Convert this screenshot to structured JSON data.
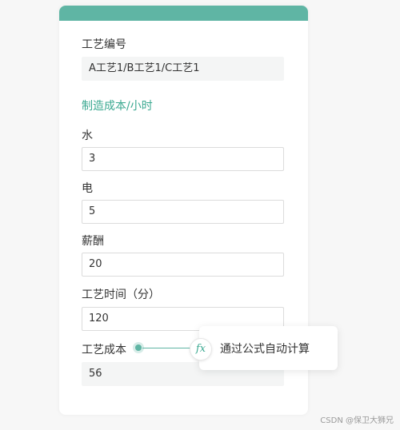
{
  "form": {
    "process_id_label": "工艺编号",
    "process_id_value": "A工艺1/B工艺1/C工艺1",
    "section_heading": "制造成本/小时",
    "water_label": "水",
    "water_value": "3",
    "electricity_label": "电",
    "electricity_value": "5",
    "salary_label": "薪酬",
    "salary_value": "20",
    "process_time_label": "工艺时间（分）",
    "process_time_value": "120",
    "process_cost_label": "工艺成本",
    "process_cost_value": "56"
  },
  "formula_tip": {
    "icon_text": "fx",
    "text": "通过公式自动计算"
  },
  "watermark": "CSDN @保卫大狮兄",
  "colors": {
    "accent": "#5fb5a4",
    "heading": "#3aa890"
  }
}
